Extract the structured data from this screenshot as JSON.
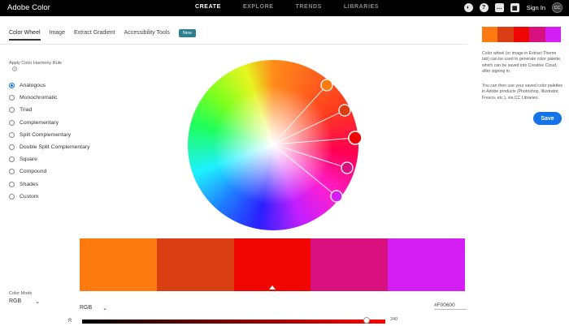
{
  "header": {
    "brand": "Adobe Color",
    "nav": [
      "CREATE",
      "EXPLORE",
      "TRENDS",
      "LIBRARIES"
    ],
    "active_nav": 0,
    "icons": [
      "moon-icon",
      "help-icon",
      "chat-icon",
      "grid-icon"
    ],
    "sign_in": "Sign In",
    "avatar": "CC"
  },
  "tabs": [
    {
      "label": "Color Wheel",
      "active": true
    },
    {
      "label": "Image",
      "active": false
    },
    {
      "label": "Extract Gradient",
      "active": false
    },
    {
      "label": "Accessibility Tools",
      "active": false
    }
  ],
  "new_badge": "New",
  "harmony": {
    "title": "Apply Color Harmony Rule",
    "rules": [
      "Analogous",
      "Monochromatic",
      "Triad",
      "Complementary",
      "Split Complementary",
      "Double Split Complementary",
      "Square",
      "Compound",
      "Shades",
      "Custom"
    ],
    "selected": 0
  },
  "color_mode": {
    "label": "Color Mode",
    "value": "RGB"
  },
  "palette": {
    "colors": [
      "#fd7a11",
      "#d93d12",
      "#f00600",
      "#d9117e",
      "#d41ff4"
    ],
    "selected": 2
  },
  "editor": {
    "mode": "RGB",
    "hex": "#F00600",
    "slider_label": "R",
    "slider_value": "240"
  },
  "sidebar": {
    "info_1": "Color wheel (or image in Extract Theme tab) can be used to generate color palette, which can be saved into Creative Cloud, after signing in.",
    "info_2": "You can then use your saved color palettes in Adobe products (Photoshop, Illustrator, Fresco, etc.), via CC Libraries.",
    "save_label": "Save"
  }
}
